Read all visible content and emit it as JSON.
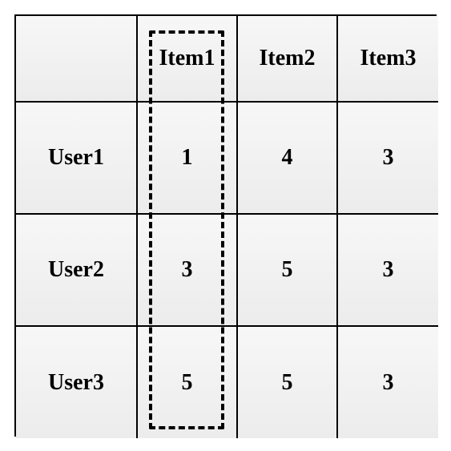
{
  "chart_data": {
    "type": "table",
    "title": "",
    "columns": [
      "",
      "Item1",
      "Item2",
      "Item3"
    ],
    "rows": [
      {
        "label": "User1",
        "values": [
          1,
          4,
          3
        ]
      },
      {
        "label": "User2",
        "values": [
          3,
          5,
          3
        ]
      },
      {
        "label": "User3",
        "values": [
          5,
          5,
          3
        ]
      }
    ],
    "highlighted_column_index": 1
  }
}
